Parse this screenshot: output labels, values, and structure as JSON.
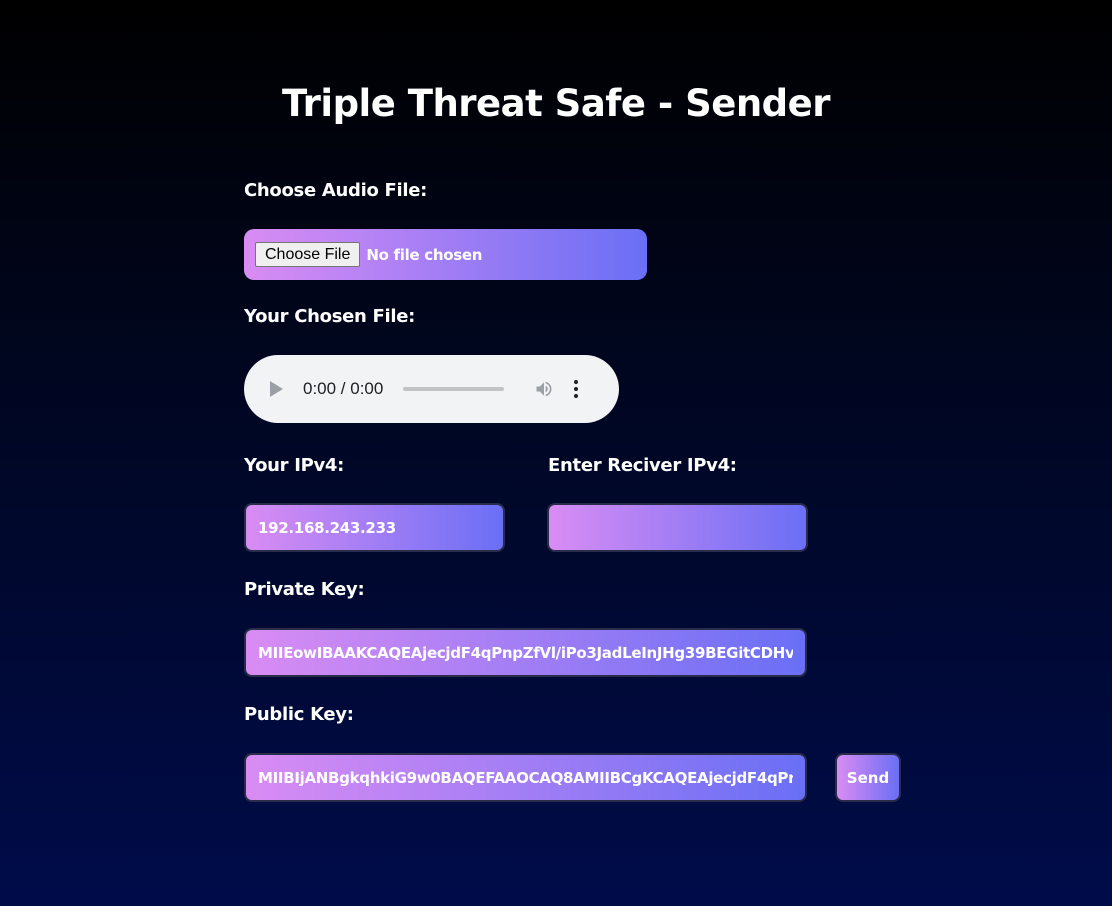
{
  "page": {
    "title": "Triple Threat Safe - Sender"
  },
  "audio_file": {
    "label": "Choose Audio File:",
    "button_label": "Choose File",
    "status": "No file chosen"
  },
  "chosen_file": {
    "label": "Your Chosen File:",
    "time_display": "0:00 / 0:00"
  },
  "your_ip": {
    "label": "Your IPv4:",
    "value": "192.168.243.233"
  },
  "receiver_ip": {
    "label": "Enter Reciver IPv4:",
    "value": ""
  },
  "private_key": {
    "label": "Private Key:",
    "value": "MIIEowIBAAKCAQEAjecjdF4qPnpZfVl/iPo3JadLeInJHg39BEGitCDHv"
  },
  "public_key": {
    "label": "Public Key:",
    "value": "MIIBIjANBgkqhkiG9w0BAQEFAAOCAQ8AMIIBCgKCAQEAjecjdF4qPr"
  },
  "send_button": {
    "label": "Send"
  },
  "colors": {
    "gradient_start": "#d98cf3",
    "gradient_end": "#6a6ff5",
    "background_top": "#000000",
    "background_bottom": "#000c4a"
  },
  "icons": {
    "play": "play-icon",
    "volume": "volume-icon",
    "more": "more-options-icon"
  }
}
